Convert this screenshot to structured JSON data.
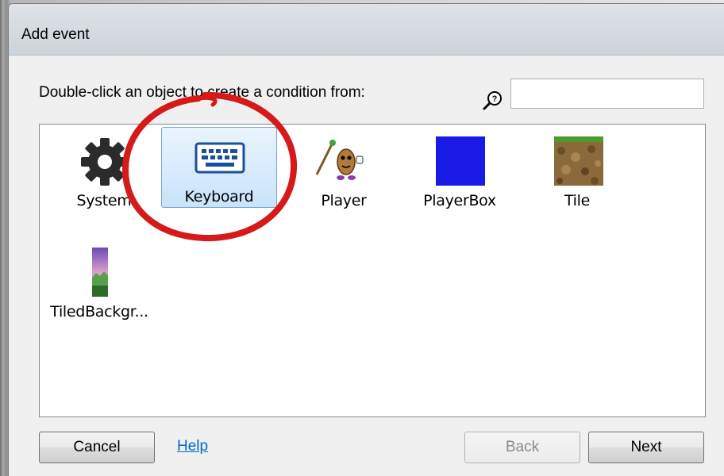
{
  "window": {
    "title": "Add event"
  },
  "prompt": "Double-click an object to create a condition from:",
  "search": {
    "value": "",
    "placeholder": ""
  },
  "objects": [
    {
      "label": "System",
      "icon": "gear-icon",
      "selected": false
    },
    {
      "label": "Keyboard",
      "icon": "keyboard-icon",
      "selected": true
    },
    {
      "label": "Player",
      "icon": "player-sprite-icon",
      "selected": false
    },
    {
      "label": "PlayerBox",
      "icon": "blue-square-icon",
      "selected": false
    },
    {
      "label": "Tile",
      "icon": "dirt-tile-icon",
      "selected": false
    },
    {
      "label": "TiledBackgr...",
      "icon": "tiled-background-icon",
      "selected": false
    }
  ],
  "buttons": {
    "cancel": "Cancel",
    "help": "Help",
    "back": "Back",
    "next": "Next"
  },
  "colors": {
    "highlight_circle": "#d61a1a",
    "playerbox": "#1a1ae6",
    "link": "#0066cc"
  }
}
